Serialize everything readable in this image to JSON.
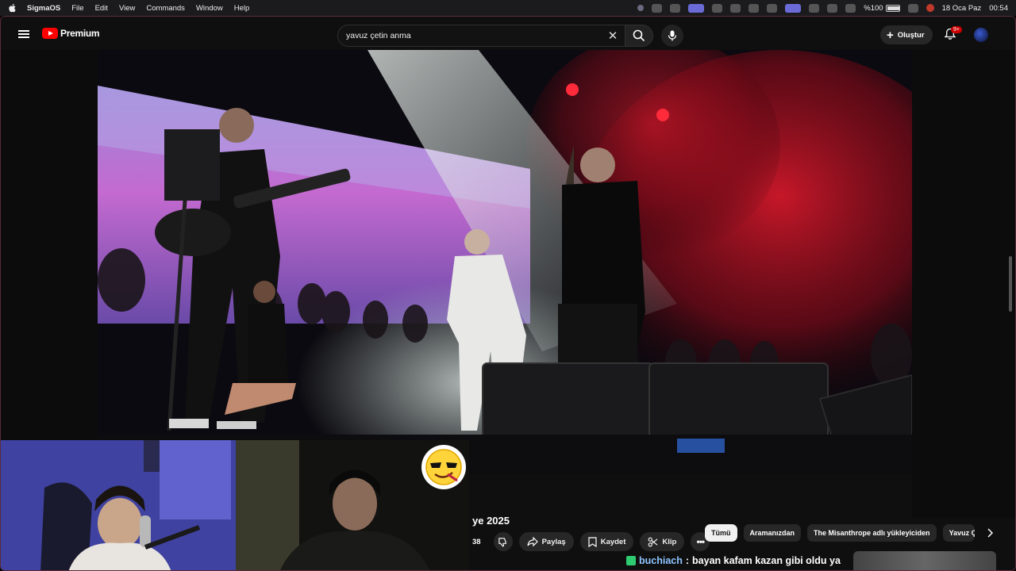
{
  "menubar": {
    "app_name": "SigmaOS",
    "items": [
      "File",
      "Edit",
      "View",
      "Commands",
      "Window",
      "Help"
    ],
    "battery": "%100",
    "date": "18 Oca Paz",
    "time": "00:54"
  },
  "youtube": {
    "brand": "Premium",
    "search_value": "yavuz çetin anma",
    "create_label": "Oluştur",
    "notification_count": "9+"
  },
  "video": {
    "title_fragment": "ye 2025"
  },
  "actions": {
    "like_count": "38",
    "share_label": "Paylaş",
    "save_label": "Kaydet",
    "clip_label": "Klip"
  },
  "chips": [
    "Tümü",
    "Aramanızdan",
    "The Misanthrope adlı yükleyiciden",
    "Yavuz Çe"
  ],
  "chat": {
    "user": "buchiach",
    "separator": ":",
    "message": "bayan kafam kazan gibi oldu ya"
  },
  "colors": {
    "youtube_red": "#ff0000",
    "bg": "#0f0f0f",
    "pill": "#272727",
    "chat_user": "#8ec5ff"
  }
}
